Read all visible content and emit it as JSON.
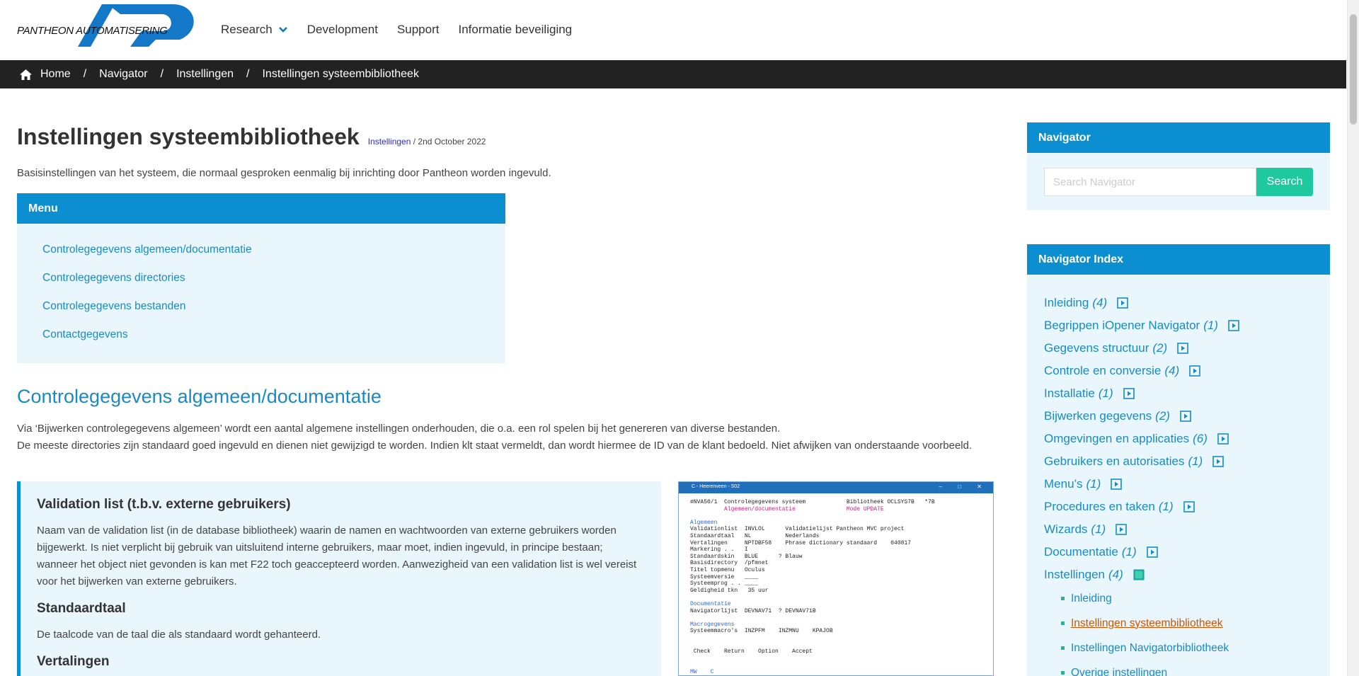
{
  "header": {
    "logo_text": "PANTHEON AUTOMATISERING",
    "nav": [
      {
        "label": "Research",
        "has_dropdown": true
      },
      {
        "label": "Development"
      },
      {
        "label": "Support"
      },
      {
        "label": "Informatie beveiliging"
      }
    ]
  },
  "breadcrumb": {
    "items": [
      "Home",
      "Navigator",
      "Instellingen",
      "Instellingen systeembibliotheek"
    ],
    "separator": "/"
  },
  "page": {
    "title": "Instellingen systeembibliotheek",
    "category": "Instellingen",
    "date": " / 2nd October 2022",
    "intro": "Basisinstellingen van het systeem, die normaal gesproken eenmalig bij inrichting door Pantheon worden ingevuld."
  },
  "menu": {
    "title": "Menu",
    "items": [
      "Controlegegevens algemeen/documentatie",
      "Controlegegevens directories",
      "Controlegegevens bestanden",
      "Contactgegevens"
    ]
  },
  "section": {
    "title": "Controlegegevens algemeen/documentatie",
    "p1": "Via ‘Bijwerken controlegegevens algemeen’ wordt een aantal algemene instellingen onderhouden, die o.a. een rol spelen bij het genereren van diverse bestanden.",
    "p2": "De meeste directories zijn standaard goed ingevuld en dienen niet gewijzigd te worden. Indien klt staat vermeldt, dan wordt hiermee de ID van de klant bedoeld. Niet afwijken van onderstaande voorbeeld."
  },
  "info": {
    "h1": "Validation list (t.b.v. externe gebruikers)",
    "p1": "Naam van de validation list (in de database bibliotheek) waarin de namen en wachtwoorden van externe gebruikers worden bijgewerkt. Is niet verplicht bij gebruik van uitsluitend interne gebruikers, maar moet, indien ingevuld, in principe bestaan; wanneer het object niet gevonden is kan met F22 toch geaccepteerd worden. Aanwezigheid van een validation list is wel vereist voor het bijwerken van externe gebruikers.",
    "h2": "Standaardtaal",
    "p2": "De taalcode van de taal die als standaard wordt gehanteerd.",
    "h3": "Vertalingen"
  },
  "screenshot": {
    "window_title": "C - Heerenveen - S02",
    "controls": "–  □  ✕",
    "lines": [
      {
        "t": "#NVA50/1  Controlegegevens systeem            Bibliotheek OCLSYS7B   *7B",
        "c": "mix1"
      },
      {
        "t": "          Algemeen/documentatie               Mode UPDATE",
        "c": "pink"
      },
      {
        "t": "",
        "c": ""
      },
      {
        "t": "Algemeen",
        "c": "blue"
      },
      {
        "t": "Validationlist  INVLOL      Validatielijst Pantheon MVC project",
        "c": ""
      },
      {
        "t": "Standaardtaal   NL          Nederlands",
        "c": ""
      },
      {
        "t": "Vertalingen     NPTDBF58    Phrase dictionary standaard    040817",
        "c": ""
      },
      {
        "t": "Markering . .   I",
        "c": ""
      },
      {
        "t": "Standaardskin   BLUE      ? Blauw",
        "c": ""
      },
      {
        "t": "Basisdirectory  /pfmnet",
        "c": ""
      },
      {
        "t": "Titel topmenu   Oculus",
        "c": ""
      },
      {
        "t": "Systeemversie   ____",
        "c": ""
      },
      {
        "t": "Systeemprog . . ____",
        "c": ""
      },
      {
        "t": "Geldigheid tkn   35 uur",
        "c": ""
      },
      {
        "t": "",
        "c": ""
      },
      {
        "t": "Documentatie",
        "c": "blue"
      },
      {
        "t": "Navigatorlijst  DEVNAV71  ? DEVNAV71B",
        "c": ""
      },
      {
        "t": "",
        "c": ""
      },
      {
        "t": "Macrogegevens",
        "c": "blue"
      },
      {
        "t": "Systeemmacro's  INZPFM    INZMNU    KPAJOB",
        "c": ""
      },
      {
        "t": "",
        "c": ""
      },
      {
        "t": "",
        "c": ""
      },
      {
        "t": " Check    Return    Option    Accept",
        "c": ""
      },
      {
        "t": "",
        "c": ""
      },
      {
        "t": "",
        "c": ""
      },
      {
        "t": "MW    C",
        "c": "blue"
      }
    ]
  },
  "sidebar": {
    "search_title": "Navigator",
    "search_placeholder": "Search Navigator",
    "search_button": "Search",
    "index_title": "Navigator Index",
    "index": [
      {
        "label": "Inleiding",
        "count": "(4)"
      },
      {
        "label": "Begrippen iOpener Navigator",
        "count": "(1)"
      },
      {
        "label": "Gegevens structuur",
        "count": "(2)"
      },
      {
        "label": "Controle en conversie",
        "count": "(4)"
      },
      {
        "label": "Installatie",
        "count": "(1)"
      },
      {
        "label": "Bijwerken gegevens",
        "count": "(2)"
      },
      {
        "label": "Omgevingen en applicaties",
        "count": "(6)"
      },
      {
        "label": "Gebruikers en autorisaties",
        "count": "(1)"
      },
      {
        "label": "Menu’s",
        "count": "(1)"
      },
      {
        "label": "Procedures en taken",
        "count": "(1)"
      },
      {
        "label": "Wizards",
        "count": "(1)"
      },
      {
        "label": "Documentatie",
        "count": "(1)"
      },
      {
        "label": "Instellingen",
        "count": "(4)",
        "expanded": true
      }
    ],
    "sub_items": [
      {
        "label": "Inleiding"
      },
      {
        "label": "Instellingen systeembibliotheek",
        "active": true
      },
      {
        "label": "Instellingen Navigatorbibliotheek"
      },
      {
        "label": "Overige instellingen"
      }
    ]
  },
  "colors": {
    "brand_blue": "#0b8fd1",
    "link_blue": "#1a8ac4",
    "search_green": "#1fc9a0",
    "active_orange": "#d35400",
    "panel_bg": "#e9f6fc",
    "breadcrumb_bg": "#222222"
  }
}
